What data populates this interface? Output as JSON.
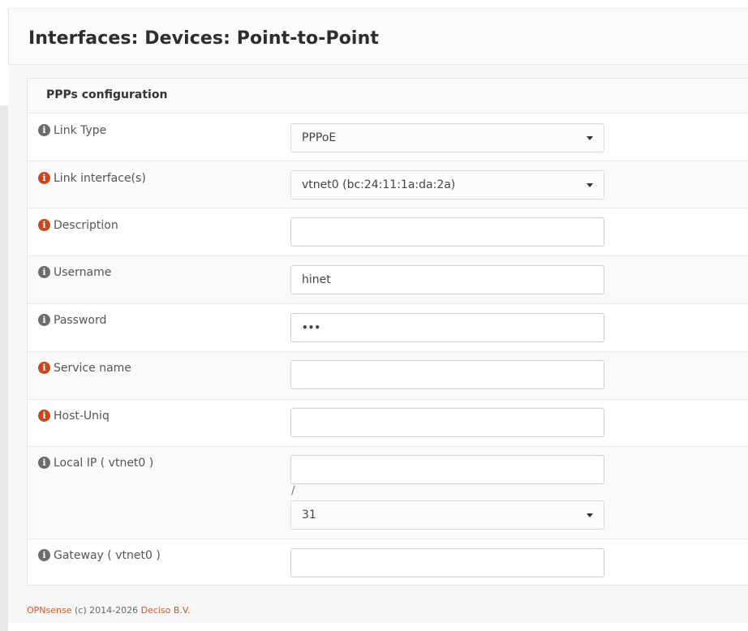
{
  "page": {
    "title": "Interfaces: Devices: Point-to-Point"
  },
  "panel": {
    "title": "PPPs configuration"
  },
  "fields": [
    {
      "label": "Link Type",
      "type": "select",
      "value": "PPPoE",
      "icon": "info-icon",
      "icon_color": "#6c6c6c"
    },
    {
      "label": "Link interface(s)",
      "type": "select",
      "value": "vtnet0 (bc:24:11:1a:da:2a)",
      "icon": "info-icon",
      "icon_color": "#c8471e"
    },
    {
      "label": "Description",
      "type": "input",
      "value": "",
      "icon": "info-icon",
      "icon_color": "#c8471e"
    },
    {
      "label": "Username",
      "type": "input",
      "value": "hinet",
      "icon": "info-icon",
      "icon_color": "#6c6c6c"
    },
    {
      "label": "Password",
      "type": "password",
      "value": "•••",
      "icon": "info-icon",
      "icon_color": "#6c6c6c"
    },
    {
      "label": "Service name",
      "type": "input",
      "value": "",
      "icon": "info-icon",
      "icon_color": "#c8471e"
    },
    {
      "label": "Host-Uniq",
      "type": "input",
      "value": "",
      "icon": "info-icon",
      "icon_color": "#c8471e"
    },
    {
      "label": "Local IP ( vtnet0 )",
      "type": "input",
      "value": "",
      "separator": "/",
      "subnet_value": "31",
      "icon": "info-icon",
      "icon_color": "#6c6c6c"
    },
    {
      "label": "Gateway ( vtnet0 )",
      "type": "input",
      "value": "",
      "icon": "info-icon",
      "icon_color": "#6c6c6c"
    }
  ],
  "footer": {
    "brand": "OPNsense",
    "copyright": "(c) 2014-2026",
    "company": "Deciso B.V."
  },
  "colors": {
    "accent": "#d4541f",
    "info_grey": "#6c6c6c",
    "info_orange": "#c8471e"
  }
}
